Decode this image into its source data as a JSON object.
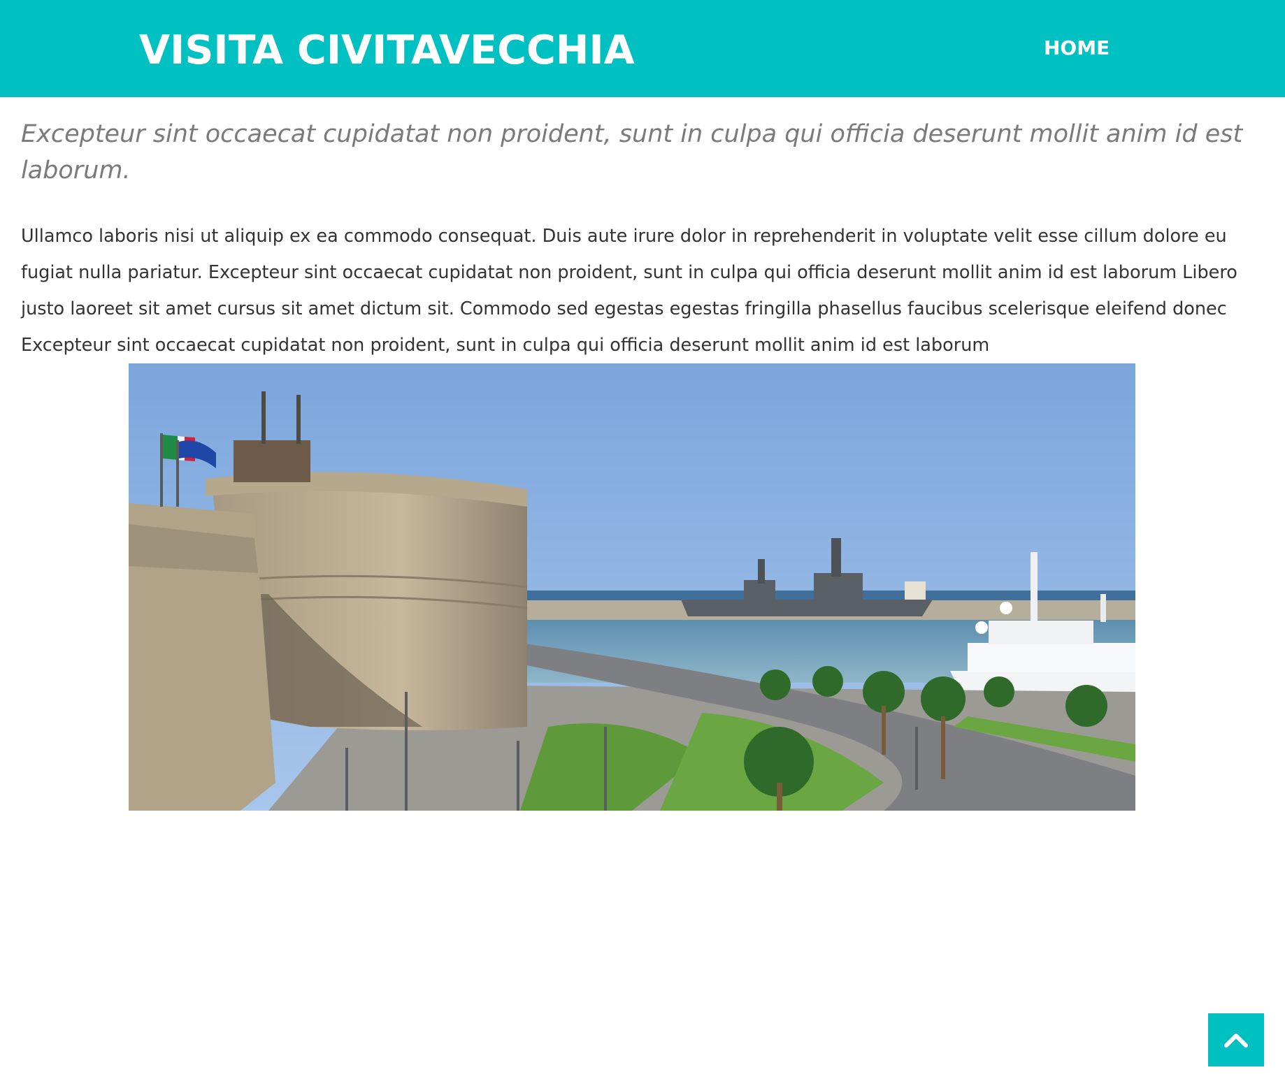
{
  "header": {
    "site_title": "VISITA CIVITAVECCHIA",
    "nav": {
      "home_label": "HOME"
    },
    "background_color": "#00c0c2"
  },
  "main": {
    "lead": "Excepteur sint occaecat cupidatat non proident, sunt in culpa qui officia deserunt mollit anim id est laborum.",
    "body": "Ullamco laboris nisi ut aliquip ex ea commodo consequat. Duis aute irure dolor in reprehenderit in voluptate velit esse cillum dolore eu fugiat nulla pariatur. Excepteur sint occaecat cupidatat non proident, sunt in culpa qui officia deserunt mollit anim id est laborum Libero justo laoreet sit amet cursus sit amet dictum sit. Commodo sed egestas egestas fringilla phasellus faucibus scelerisque eleifend donec Excepteur sint occaecat cupidatat non proident, sunt in culpa qui officia deserunt mollit anim id est laborum"
  },
  "back_to_top": {
    "icon": "chevron-up-icon",
    "color": "#00c0c2"
  }
}
